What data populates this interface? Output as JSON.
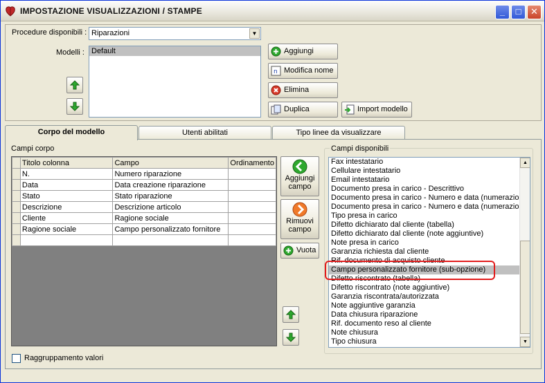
{
  "window": {
    "title": "IMPOSTAZIONE VISUALIZZAZIONI / STAMPE",
    "minimize": "_",
    "maximize": "□",
    "close": "✕"
  },
  "top": {
    "procedure_label": "Procedure disponibili :",
    "procedure_value": "Riparazioni",
    "models_label": "Modelli :",
    "models": [
      "Default"
    ],
    "buttons": {
      "add": "Aggiungi",
      "rename": "Modifica nome",
      "delete": "Elimina",
      "duplicate": "Duplica",
      "import": "Import modello"
    }
  },
  "tabs": [
    "Corpo del modello",
    "Utenti abilitati",
    "Tipo linee da visualizzare"
  ],
  "body": {
    "fields_label": "Campi corpo",
    "columns": [
      "Titolo colonna",
      "Campo",
      "Ordinamento"
    ],
    "rows": [
      [
        "N.",
        "Numero riparazione",
        ""
      ],
      [
        "Data",
        "Data creazione riparazione",
        ""
      ],
      [
        "Stato",
        "Stato riparazione",
        ""
      ],
      [
        "Descrizione",
        "Descrizione articolo",
        ""
      ],
      [
        "Cliente",
        "Ragione sociale",
        ""
      ],
      [
        "Ragione sociale",
        "Campo personalizzato fornitore",
        ""
      ],
      [
        "",
        "",
        ""
      ]
    ],
    "add_field": [
      "Aggiungi",
      "campo"
    ],
    "remove_field": [
      "Rimuovi",
      "campo"
    ],
    "empty": "Vuota",
    "grouping_label": "Raggruppamento valori",
    "available_label": "Campi disponibili",
    "available": [
      "Fax intestatario",
      "Cellulare intestatario",
      "Email intestatario",
      "Documento presa in carico - Descrittivo",
      "Documento presa in carico - Numero e data (numerazione",
      "Documento presa in carico - Numero e data (numerazione",
      "Tipo presa in carico",
      "Difetto dichiarato dal cliente (tabella)",
      "Difetto dichiarato dal cliente (note aggiuntive)",
      "Note presa in carico",
      "Garanzia richiesta dal cliente",
      "Rif. documento di acquisto cliente",
      "Campo personalizzato fornitore (sub-opzione)",
      "Difetto riscontrato (tabella)",
      "Difetto riscontrato (note aggiuntive)",
      "Garanzia riscontrata/autorizzata",
      "Note aggiuntive garanzia",
      "Data chiusura riparazione",
      "Rif. documento reso al cliente",
      "Note chiusura",
      "Tipo chiusura"
    ],
    "selected_index": 12
  },
  "colors": {
    "highlight": "#e21b1b",
    "selection": "#c0c0c0",
    "window_bg": "#ece9d8"
  }
}
